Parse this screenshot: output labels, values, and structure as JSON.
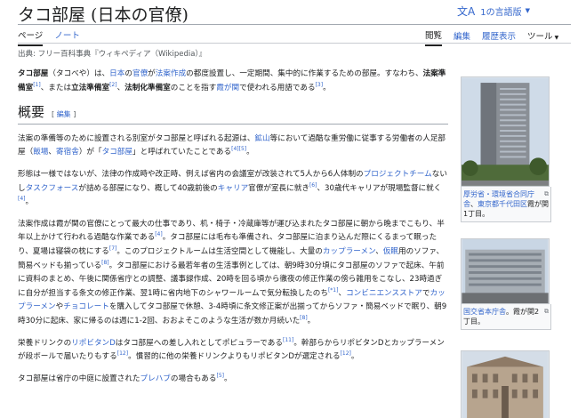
{
  "page": {
    "title": "タコ部屋 (日本の官僚)",
    "language_button": "1の言語版",
    "language_icon": "translate-icon"
  },
  "tabs": {
    "page": "ページ",
    "talk": "ノート",
    "read": "閲覧",
    "edit": "編集",
    "history": "履歴表示",
    "tools": "ツール"
  },
  "source_line": "出典: フリー百科事典『ウィキペディア（Wikipedia）』",
  "intro": {
    "t1": "タコ部屋",
    "t2": "（タコべや）は、",
    "l1": "日本",
    "t3": "の",
    "l2": "官僚",
    "t4": "が",
    "l3": "法案作成",
    "t5": "の都度設置し、一定期間、集中的に作業するための部屋。すなわち、",
    "b1": "法案準備室",
    "r1": "[1]",
    "t6": "、または",
    "b2": "立法準備室",
    "r2": "[2]",
    "t7": "、",
    "b3": "法制化準備室",
    "t8": "のことを指す",
    "l4": "霞が関",
    "t9": "で使われる用語である",
    "r3": "[3]",
    "t10": "。"
  },
  "overview": {
    "heading": "概要",
    "edit_link": "編集",
    "edit_open": "[",
    "edit_close": "]"
  },
  "para1": {
    "t1": "法案の準備等のために設置される別室がタコ部屋と呼ばれる起源は、",
    "l1": "鉱山",
    "t2": "等において過酷な重労働に従事する労働者の人足部屋（",
    "l2": "飯場",
    "t3": "、",
    "l3": "寄宿舎",
    "t4": "）が「",
    "l4": "タコ部屋",
    "t5": "」と呼ばれていたことである",
    "r1": "[4]",
    "r2": "[5]",
    "t6": "。"
  },
  "para2": {
    "t1": "形態は一様ではないが、法律の作成時や改正時、例えば省内の会議室が改装されて5人から6人体制の",
    "l1": "プロジェクトチーム",
    "t2": "ないし",
    "l2": "タスクフォース",
    "t3": "が詰める部屋になり、概して40歳前後の",
    "l3": "キャリア",
    "t4": "官僚が室長に就き",
    "r1": "[6]",
    "t5": "、30歳代キャリアが現場監督に就く",
    "r2": "[4]",
    "t6": "。"
  },
  "para3": {
    "t1": "法案作成は霞が関の官僚にとって最大の仕事であり、机・椅子・冷蔵庫等が運び込まれたタコ部屋に朝から晩までこもり、半年以上かけて行われる過酷な作業である",
    "r1": "[4]",
    "t2": "。タコ部屋には毛布も準備され、タコ部屋に泊まり込んだ際にくるまって眠ったり、夏場は寝袋の枕にする",
    "r2": "[7]",
    "t3": "。このプロジェクトルームは生活空間として機能し、大量の",
    "l1": "カップラーメン",
    "t4": "、",
    "l2": "仮眠",
    "t5": "用のソファ、簡易ベッドも揃っている",
    "r3": "[8]",
    "t6": "。タコ部屋における最若年者の生活事例としては、朝9時30分頃にタコ部屋のソファで起床、午前に資料のまとめ、午後に関係省庁との調整、議事録作成、20時を回る頃から徹夜の修正作業の傍ら雑用をこなし、23時過ぎに自分が担当する条文の修正作業、翌1時に省内地下のシャワールームで気分転換したのち",
    "r4": "[*1]",
    "t7": "、",
    "l3": "コンビニエンスストア",
    "t8": "で",
    "l4": "カップラーメン",
    "t9": "や",
    "l5": "チョコレート",
    "t10": "を購入してタコ部屋で休憩、3-4時頃に条文修正案が出揃ってからソファ・簡易ベッドで眠り、朝9時30分に起床、家に帰るのは週に1-2回、おおよそこのような生活が数か月続いた",
    "r5": "[8]",
    "t11": "。"
  },
  "para4": {
    "t1": "栄養ドリンクの",
    "l1": "リポビタンD",
    "t2": "はタコ部屋への差し入れとしてポピュラーである",
    "r1": "[11]",
    "t3": "。幹部らからリポビタンDとカップラーメンが段ボールで届いたりもする",
    "r2": "[12]",
    "t4": "。慣習的に他の栄養ドリンクよりもリポビタンDが選定される",
    "r3": "[12]",
    "t5": "。"
  },
  "para5": {
    "t1": "タコ部屋は省庁の中庭に設置された",
    "l1": "プレハブ",
    "t2": "の場合もある",
    "r1": "[5]",
    "t3": "。"
  },
  "figures": [
    {
      "caption_link1": "厚労省・環境省合同庁舎",
      "caption_text": "、",
      "caption_link2": "東京都千代田区",
      "caption_text2": "霞が関1丁目。",
      "enlarge_icon": "enlarge-icon"
    },
    {
      "caption_link1": "国交省本庁舎",
      "caption_text": "。霞が関2丁目。",
      "enlarge_icon": "enlarge-icon"
    },
    {
      "caption_link1": "",
      "caption_text": ""
    }
  ]
}
